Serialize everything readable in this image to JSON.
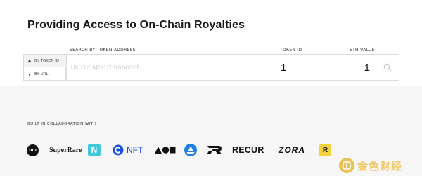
{
  "page": {
    "title": "Providing Access to On-Chain Royalties"
  },
  "search": {
    "modes": [
      {
        "label": "BY TOKEN ID",
        "selected": true
      },
      {
        "label": "BY URL",
        "selected": false
      }
    ],
    "address_label": "SEARCH BY TOKEN ADDRESS",
    "address_placeholder": "0x0123456789abcdef",
    "token_id_label": "TOKEN ID",
    "token_id_value": "1",
    "eth_label": "ETH VALUE",
    "eth_value": "1"
  },
  "collaboration": {
    "heading": "BUILT IN COLLABORATION WITH",
    "partners": [
      {
        "name": "mp",
        "icon": "mp-circle-icon"
      },
      {
        "name": "SuperRare",
        "icon": "superrare-wordmark"
      },
      {
        "name": "N",
        "icon": "nifty-gateway-icon",
        "color": "#3ec8de"
      },
      {
        "name": "NFT",
        "icon": "c-nft-icon",
        "color": "#1e4fd9"
      },
      {
        "name": "",
        "icon": "triangle-circle-square-icon"
      },
      {
        "name": "",
        "icon": "opensea-boat-icon",
        "color": "#2081e2"
      },
      {
        "name": "",
        "icon": "rarible-r-icon"
      },
      {
        "name": "RECUR",
        "icon": "recur-wordmark"
      },
      {
        "name": "ZORA",
        "icon": "zora-wordmark"
      },
      {
        "name": "R",
        "icon": "yellow-r-square-icon",
        "color": "#f4d23c"
      }
    ]
  },
  "watermark": {
    "text": "金色财经",
    "icon": "coin-logo-icon",
    "color": "#f0c14b"
  }
}
